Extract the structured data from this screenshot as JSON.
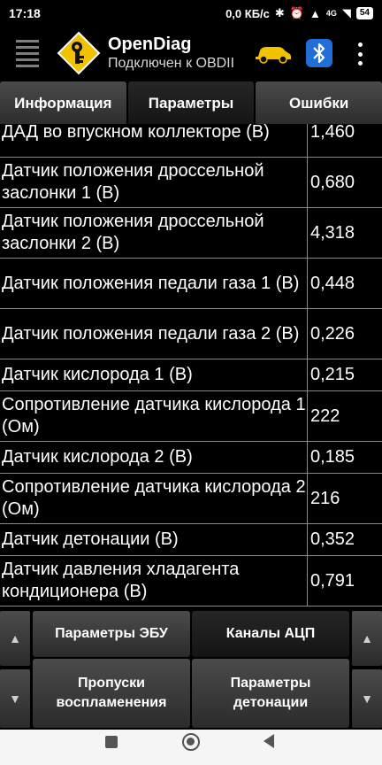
{
  "status": {
    "time": "17:18",
    "speed": "0,0 КБ/с",
    "network": "4G",
    "battery": "54"
  },
  "app": {
    "title": "OpenDiag",
    "subtitle": "Подключен к OBDII"
  },
  "tabs": [
    {
      "label": "Информация"
    },
    {
      "label": "Параметры"
    },
    {
      "label": "Ошибки"
    }
  ],
  "parameters": [
    {
      "name": "ДАД во впускном коллекторе (В)",
      "value": "1,460"
    },
    {
      "name": "Датчик положения дроссельной заслонки 1 (В)",
      "value": "0,680"
    },
    {
      "name": "Датчик положения дроссельной заслонки 2 (В)",
      "value": "4,318"
    },
    {
      "name": "Датчик положения педали газа 1 (В)",
      "value": "0,448"
    },
    {
      "name": "Датчик положения педали газа 2 (В)",
      "value": "0,226"
    },
    {
      "name": "Датчик кислорода 1 (В)",
      "value": "0,215"
    },
    {
      "name": "Сопротивление датчика кислорода 1 (Ом)",
      "value": "222"
    },
    {
      "name": "Датчик кислорода 2 (В)",
      "value": "0,185"
    },
    {
      "name": "Сопротивление датчика кислорода 2 (Ом)",
      "value": "216"
    },
    {
      "name": "Датчик детонации (В)",
      "value": "0,352"
    },
    {
      "name": "Датчик давления хладагента кондиционера (В)",
      "value": "0,791"
    }
  ],
  "bottom": {
    "btn_ecu_params": "Параметры ЭБУ",
    "btn_adc_channels": "Каналы АЦП",
    "btn_misfires": "Пропуски воспламенения",
    "btn_knock_params": "Параметры детонации",
    "arrow_up": "▲",
    "arrow_down": "▼"
  },
  "colors": {
    "background": "#000000",
    "tab": "#3a3a3a",
    "tab_active": "#1c1c1c",
    "divider": "#8a8a8a",
    "nav_bar": "#f5f5f5"
  }
}
